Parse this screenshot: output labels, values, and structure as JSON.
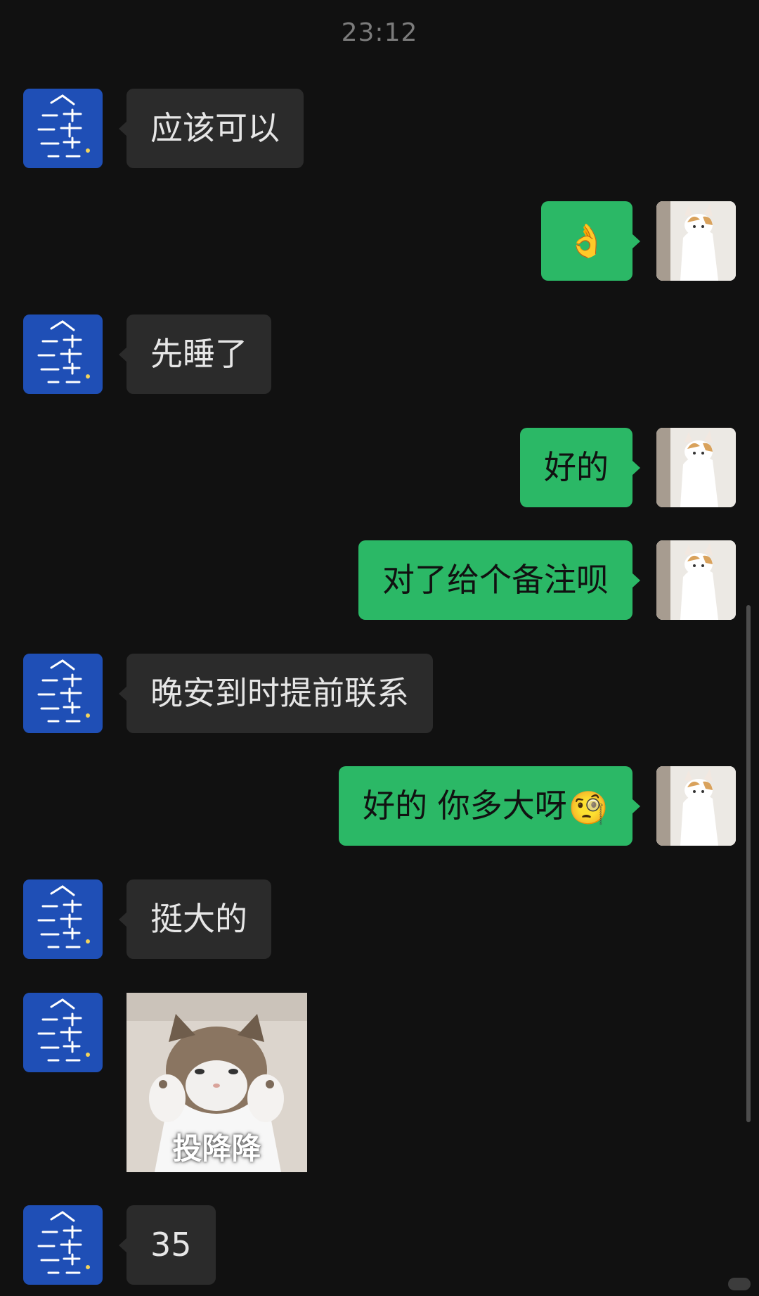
{
  "chat": {
    "time_divider": "23:12",
    "messages": [
      {
        "side": "left",
        "kind": "text",
        "text": "应该可以"
      },
      {
        "side": "right",
        "kind": "emoji",
        "emoji": "👌"
      },
      {
        "side": "left",
        "kind": "text",
        "text": "先睡了"
      },
      {
        "side": "right",
        "kind": "text",
        "text": "好的"
      },
      {
        "side": "right",
        "kind": "text",
        "text": "对了给个备注呗"
      },
      {
        "side": "left",
        "kind": "text",
        "text": "晚安到时提前联系"
      },
      {
        "side": "right",
        "kind": "text",
        "text": "好的 你多大呀",
        "trailing_emoji": "🧐"
      },
      {
        "side": "left",
        "kind": "text",
        "text": "挺大的"
      },
      {
        "side": "left",
        "kind": "sticker",
        "caption": "投降降"
      },
      {
        "side": "left",
        "kind": "text",
        "text": "35"
      }
    ]
  },
  "avatars": {
    "contact_icon": "blue-calligraphy-avatar",
    "self_icon": "white-cat-raising-paws-avatar"
  },
  "colors": {
    "background": "#111111",
    "incoming_bubble": "#2b2b2b",
    "outgoing_bubble": "#2bb866",
    "contact_avatar": "#1f4fb6"
  }
}
